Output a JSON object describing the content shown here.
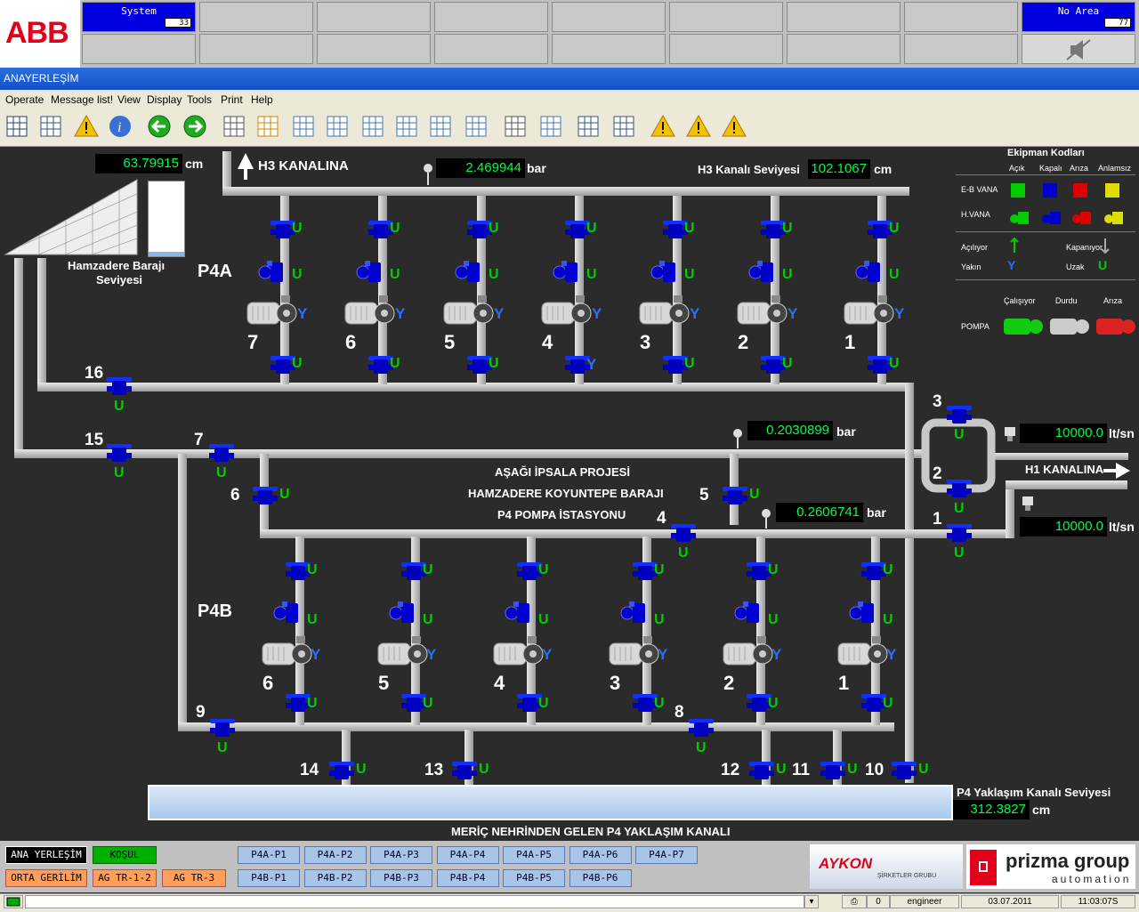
{
  "logo": "ABB",
  "alarm_band": {
    "system_label": "System",
    "system_count": "33",
    "area_label": "No Area",
    "area_count": "77"
  },
  "window_title": "ANAYERLEŞİM",
  "menu": [
    "Operate",
    "Message list!",
    "View",
    "Display",
    "Tools",
    "Print",
    "Help"
  ],
  "toolbar_icons": [
    "grid-icon",
    "bars-icon",
    "warning-icon",
    "info-icon",
    "back-arrow-icon",
    "forward-arrow-icon",
    "clipboard-icon",
    "picture-icon",
    "table-icon",
    "trend-icon",
    "document-icon",
    "tree-icon",
    "globe-icon",
    "settings-icon",
    "keyboard-icon",
    "chart-add-icon",
    "windows-icon",
    "layout-icon",
    "alarm-list-icon",
    "alarm-active-icon",
    "alarm-ack-icon"
  ],
  "colors": {
    "valve_blue": "#0000d0",
    "status_green": "#00ff40",
    "alarm_red": "#e2001a"
  },
  "process": {
    "dam_level_value": "63.79915",
    "dam_level_unit": "cm",
    "dam_label_1": "Hamzadere Barajı",
    "dam_label_2": "Seviyesi",
    "h3_outlet": "H3 KANALINA",
    "h3_pressure": "2.469944",
    "pressure_unit": "bar",
    "h3_level_label": "H3 Kanalı Seviyesi",
    "h3_level_value": "102.1067",
    "level_unit": "cm",
    "p4a": "P4A",
    "p4b": "P4B",
    "mid_pressure": "0.2030899",
    "low_pressure": "0.2606741",
    "flow1": "10000.0",
    "flow2": "10000.0",
    "flow_unit": "lt/sn",
    "h1_outlet": "H1 KANALINA",
    "center_1": "AŞAĞI İPSALA PROJESİ",
    "center_2": "HAMZADERE KOYUNTEPE BARAJI",
    "center_3": "P4 POMPA İSTASYONU",
    "approach_level_label": "P4 Yaklaşım Kanalı Seviyesi",
    "approach_level_value": "312.3827",
    "canal_label": "MERİÇ NEHRİNDEN GELEN P4 YAKLAŞIM KANALI",
    "p4a_pumps": [
      "7",
      "6",
      "5",
      "4",
      "3",
      "2",
      "1"
    ],
    "p4b_pumps": [
      "6",
      "5",
      "4",
      "3",
      "2",
      "1"
    ],
    "valve_numbers": {
      "v16": "16",
      "v15": "15",
      "v7": "7",
      "v6": "6",
      "v5": "5",
      "v4": "4",
      "v3": "3",
      "v2": "2",
      "v1": "1",
      "v9": "9",
      "v8": "8",
      "v14": "14",
      "v13": "13",
      "v12": "12",
      "v11": "11",
      "v10": "10"
    },
    "u": "U",
    "y": "Y"
  },
  "legend": {
    "title": "Ekipman Kodları",
    "col_open": "Açık",
    "col_closed": "Kapalı",
    "col_fault": "Arıza",
    "col_undefined": "Anlamsız",
    "row_eb": "E-B VANA",
    "row_h": "H.VANA",
    "opening": "Açılıyor",
    "closing": "Kapanıyor",
    "near": "Yakın",
    "far": "Uzak",
    "near_sym": "Y",
    "far_sym": "U",
    "run": "Çalışıyor",
    "stopped": "Durdu",
    "fault": "Arıza",
    "pump": "POMPA"
  },
  "nav": {
    "ana": "ANA YERLEŞİM",
    "kosul": "KOŞUL",
    "orta": "ORTA GERİLİM",
    "ag1": "AG TR-1-2",
    "ag3": "AG TR-3",
    "p4a": [
      "P4A-P1",
      "P4A-P2",
      "P4A-P3",
      "P4A-P4",
      "P4A-P5",
      "P4A-P6",
      "P4A-P7"
    ],
    "p4b": [
      "P4B-P1",
      "P4B-P2",
      "P4B-P3",
      "P4B-P4",
      "P4B-P5",
      "P4B-P6"
    ]
  },
  "brand": {
    "aykon": "AYKON",
    "aykon_sub": "ŞİRKETLER GRUBU",
    "prizma": "prizma group",
    "prizma_sub": "automation"
  },
  "status": {
    "count": "0",
    "user": "engineer",
    "date": "03.07.2011",
    "time": "11:03:07S"
  }
}
